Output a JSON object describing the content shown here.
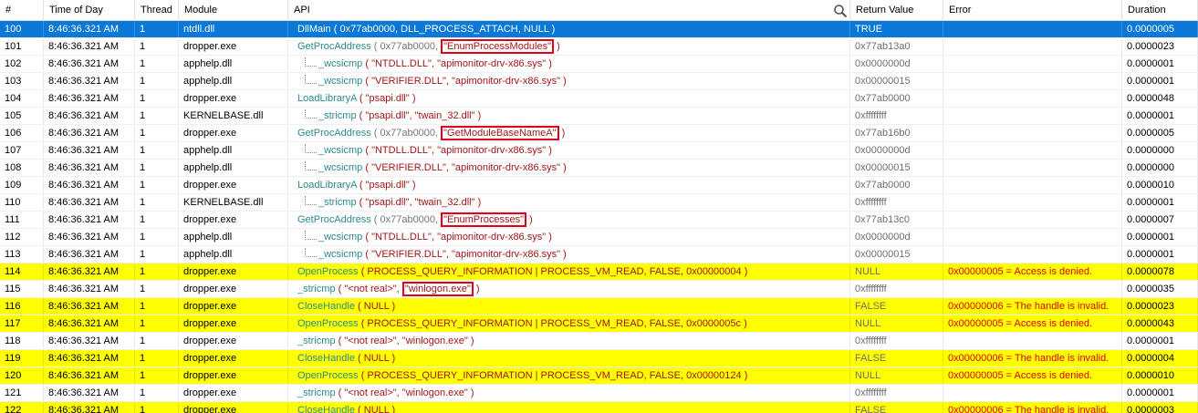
{
  "columns": {
    "num": "#",
    "time": "Time of Day",
    "thread": "Thread",
    "module": "Module",
    "api": "API",
    "ret": "Return Value",
    "err": "Error",
    "dur": "Duration"
  },
  "icons": {
    "search": "search-icon"
  },
  "rows": [
    {
      "num": "100",
      "time": "8:46:36.321 AM",
      "thread": "1",
      "module": "ntdll.dll",
      "api": {
        "fn": "DllMain",
        "args": " ( 0x77ab0000, DLL_PROCESS_ATTACH, NULL )"
      },
      "ret": "TRUE",
      "err": "",
      "dur": "0.0000005",
      "style": "sel",
      "indent": 0
    },
    {
      "num": "101",
      "time": "8:46:36.321 AM",
      "thread": "1",
      "module": "dropper.exe",
      "api": {
        "fn": "GetProcAddress",
        "pre": " ( 0x77ab0000, ",
        "box": "\"EnumProcessModules\"",
        "post": " )"
      },
      "ret": "0x77ab13a0",
      "err": "",
      "dur": "0.0000023",
      "style": "",
      "indent": 0
    },
    {
      "num": "102",
      "time": "8:46:36.321 AM",
      "thread": "1",
      "module": "apphelp.dll",
      "api": {
        "fn": "_wcsicmp",
        "args": " ( \"NTDLL.DLL\", \"apimonitor-drv-x86.sys\" )"
      },
      "ret": "0x0000000d",
      "err": "",
      "dur": "0.0000001",
      "style": "",
      "indent": 1
    },
    {
      "num": "103",
      "time": "8:46:36.321 AM",
      "thread": "1",
      "module": "apphelp.dll",
      "api": {
        "fn": "_wcsicmp",
        "args": " ( \"VERIFIER.DLL\", \"apimonitor-drv-x86.sys\" )"
      },
      "ret": "0x00000015",
      "err": "",
      "dur": "0.0000001",
      "style": "",
      "indent": 1
    },
    {
      "num": "104",
      "time": "8:46:36.321 AM",
      "thread": "1",
      "module": "dropper.exe",
      "api": {
        "fn": "LoadLibraryA",
        "args": " ( \"psapi.dll\" )"
      },
      "ret": "0x77ab0000",
      "err": "",
      "dur": "0.0000048",
      "style": "",
      "indent": 0
    },
    {
      "num": "105",
      "time": "8:46:36.321 AM",
      "thread": "1",
      "module": "KERNELBASE.dll",
      "api": {
        "fn": "_stricmp",
        "args": " ( \"psapi.dll\", \"twain_32.dll\" )"
      },
      "ret": "0xffffffff",
      "err": "",
      "dur": "0.0000001",
      "style": "",
      "indent": 1
    },
    {
      "num": "106",
      "time": "8:46:36.321 AM",
      "thread": "1",
      "module": "dropper.exe",
      "api": {
        "fn": "GetProcAddress",
        "pre": " ( 0x77ab0000, ",
        "box": "\"GetModuleBaseNameA\"",
        "post": " )"
      },
      "ret": "0x77ab16b0",
      "err": "",
      "dur": "0.0000005",
      "style": "",
      "indent": 0
    },
    {
      "num": "107",
      "time": "8:46:36.321 AM",
      "thread": "1",
      "module": "apphelp.dll",
      "api": {
        "fn": "_wcsicmp",
        "args": " ( \"NTDLL.DLL\", \"apimonitor-drv-x86.sys\" )"
      },
      "ret": "0x0000000d",
      "err": "",
      "dur": "0.0000000",
      "style": "",
      "indent": 1
    },
    {
      "num": "108",
      "time": "8:46:36.321 AM",
      "thread": "1",
      "module": "apphelp.dll",
      "api": {
        "fn": "_wcsicmp",
        "args": " ( \"VERIFIER.DLL\", \"apimonitor-drv-x86.sys\" )"
      },
      "ret": "0x00000015",
      "err": "",
      "dur": "0.0000000",
      "style": "",
      "indent": 1
    },
    {
      "num": "109",
      "time": "8:46:36.321 AM",
      "thread": "1",
      "module": "dropper.exe",
      "api": {
        "fn": "LoadLibraryA",
        "args": " ( \"psapi.dll\" )"
      },
      "ret": "0x77ab0000",
      "err": "",
      "dur": "0.0000010",
      "style": "",
      "indent": 0
    },
    {
      "num": "110",
      "time": "8:46:36.321 AM",
      "thread": "1",
      "module": "KERNELBASE.dll",
      "api": {
        "fn": "_stricmp",
        "args": " ( \"psapi.dll\", \"twain_32.dll\" )"
      },
      "ret": "0xffffffff",
      "err": "",
      "dur": "0.0000001",
      "style": "",
      "indent": 1
    },
    {
      "num": "111",
      "time": "8:46:36.321 AM",
      "thread": "1",
      "module": "dropper.exe",
      "api": {
        "fn": "GetProcAddress",
        "pre": " ( 0x77ab0000, ",
        "box": "\"EnumProcesses\"",
        "post": " )"
      },
      "ret": "0x77ab13c0",
      "err": "",
      "dur": "0.0000007",
      "style": "",
      "indent": 0
    },
    {
      "num": "112",
      "time": "8:46:36.321 AM",
      "thread": "1",
      "module": "apphelp.dll",
      "api": {
        "fn": "_wcsicmp",
        "args": " ( \"NTDLL.DLL\", \"apimonitor-drv-x86.sys\" )"
      },
      "ret": "0x0000000d",
      "err": "",
      "dur": "0.0000001",
      "style": "",
      "indent": 1
    },
    {
      "num": "113",
      "time": "8:46:36.321 AM",
      "thread": "1",
      "module": "apphelp.dll",
      "api": {
        "fn": "_wcsicmp",
        "args": " ( \"VERIFIER.DLL\", \"apimonitor-drv-x86.sys\" )"
      },
      "ret": "0x00000015",
      "err": "",
      "dur": "0.0000001",
      "style": "",
      "indent": 1
    },
    {
      "num": "114",
      "time": "8:46:36.321 AM",
      "thread": "1",
      "module": "dropper.exe",
      "api": {
        "fn": "OpenProcess",
        "args": " ( PROCESS_QUERY_INFORMATION | PROCESS_VM_READ, FALSE, 0x00000004 )"
      },
      "ret": "NULL",
      "err": "0x00000005 = Access is denied.",
      "dur": "0.0000078",
      "style": "warn",
      "indent": 0
    },
    {
      "num": "115",
      "time": "8:46:36.321 AM",
      "thread": "1",
      "module": "dropper.exe",
      "api": {
        "fn": "_stricmp",
        "pre": " ( \"<not real>\", ",
        "box": "\"winlogon.exe\"",
        "post": " )"
      },
      "ret": "0xffffffff",
      "err": "",
      "dur": "0.0000035",
      "style": "",
      "indent": 0
    },
    {
      "num": "116",
      "time": "8:46:36.321 AM",
      "thread": "1",
      "module": "dropper.exe",
      "api": {
        "fn": "CloseHandle",
        "args": " ( NULL )"
      },
      "ret": "FALSE",
      "err": "0x00000006 = The handle is invalid.",
      "dur": "0.0000023",
      "style": "warn",
      "indent": 0
    },
    {
      "num": "117",
      "time": "8:46:36.321 AM",
      "thread": "1",
      "module": "dropper.exe",
      "api": {
        "fn": "OpenProcess",
        "args": " ( PROCESS_QUERY_INFORMATION | PROCESS_VM_READ, FALSE, 0x0000005c )"
      },
      "ret": "NULL",
      "err": "0x00000005 = Access is denied.",
      "dur": "0.0000043",
      "style": "warn",
      "indent": 0
    },
    {
      "num": "118",
      "time": "8:46:36.321 AM",
      "thread": "1",
      "module": "dropper.exe",
      "api": {
        "fn": "_stricmp",
        "args": " ( \"<not real>\", \"winlogon.exe\" )"
      },
      "ret": "0xffffffff",
      "err": "",
      "dur": "0.0000001",
      "style": "",
      "indent": 0
    },
    {
      "num": "119",
      "time": "8:46:36.321 AM",
      "thread": "1",
      "module": "dropper.exe",
      "api": {
        "fn": "CloseHandle",
        "args": " ( NULL )"
      },
      "ret": "FALSE",
      "err": "0x00000006 = The handle is invalid.",
      "dur": "0.0000004",
      "style": "warn",
      "indent": 0
    },
    {
      "num": "120",
      "time": "8:46:36.321 AM",
      "thread": "1",
      "module": "dropper.exe",
      "api": {
        "fn": "OpenProcess",
        "args": " ( PROCESS_QUERY_INFORMATION | PROCESS_VM_READ, FALSE, 0x00000124 )"
      },
      "ret": "NULL",
      "err": "0x00000005 = Access is denied.",
      "dur": "0.0000010",
      "style": "warn",
      "indent": 0
    },
    {
      "num": "121",
      "time": "8:46:36.321 AM",
      "thread": "1",
      "module": "dropper.exe",
      "api": {
        "fn": "_stricmp",
        "args": " ( \"<not real>\", \"winlogon.exe\" )"
      },
      "ret": "0xffffffff",
      "err": "",
      "dur": "0.0000001",
      "style": "",
      "indent": 0
    },
    {
      "num": "122",
      "time": "8:46:36.321 AM",
      "thread": "1",
      "module": "dropper.exe",
      "api": {
        "fn": "CloseHandle",
        "args": " ( NULL )"
      },
      "ret": "FALSE",
      "err": "0x00000006 = The handle is invalid.",
      "dur": "0.0000003",
      "style": "warn",
      "indent": 0
    }
  ]
}
